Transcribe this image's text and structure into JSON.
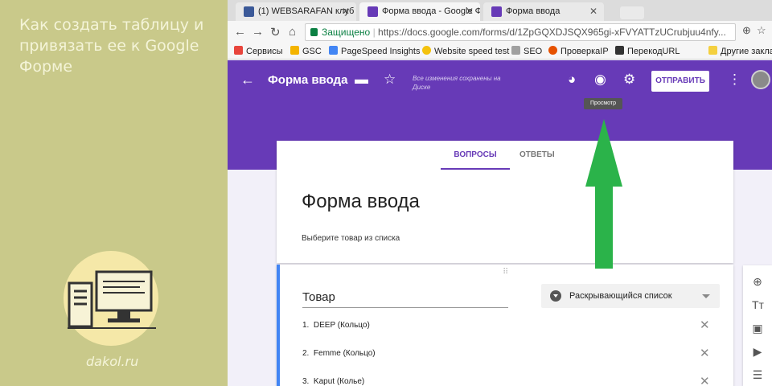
{
  "left": {
    "title": "Как создать таблицу и привязать ее к Google Форме",
    "site": "dakol.ru"
  },
  "tabs": [
    {
      "label": "(1) WEBSARAFAN клуб д",
      "icon": "facebook-icon"
    },
    {
      "label": "Форма ввода - Google Ф",
      "icon": "google-forms-icon"
    },
    {
      "label": "Форма ввода",
      "icon": "google-forms-icon"
    }
  ],
  "address": {
    "secure_label": "Защищено",
    "url": "https://docs.google.com/forms/d/1ZpGQXDJSQX965gi-xFVYATTzUCrubjuu4nfy..."
  },
  "bookmarks": [
    {
      "label": "Сервисы",
      "color": "#e8453c"
    },
    {
      "label": "GSC",
      "color": "#f4b400"
    },
    {
      "label": "PageSpeed Insights",
      "color": "#4285f4"
    },
    {
      "label": "Website speed test",
      "color": "#f4c20d"
    },
    {
      "label": "SEO",
      "color": "#a0a0a0"
    },
    {
      "label": "ПроверкаIP",
      "color": "#e65100"
    },
    {
      "label": "ПерекодURL",
      "color": "#333333"
    },
    {
      "label": "Другие закла",
      "color": "#f4d03f"
    }
  ],
  "header": {
    "title": "Форма ввода",
    "saved": "Все изменения сохранены на Диске",
    "send_label": "ОТПРАВИТЬ",
    "tooltip": "Просмотр",
    "accent": "#673ab7"
  },
  "form": {
    "tab_questions": "ВОПРОСЫ",
    "tab_answers": "ОТВЕТЫ",
    "title": "Форма ввода",
    "description": "Выберите товар из списка"
  },
  "question": {
    "title": "Товар",
    "type": "Раскрывающийся список",
    "options": [
      {
        "num": "1.",
        "label": "DEEP (Кольцо)"
      },
      {
        "num": "2.",
        "label": "Femme (Кольцо)"
      },
      {
        "num": "3.",
        "label": "Kaput (Колье)"
      }
    ]
  }
}
